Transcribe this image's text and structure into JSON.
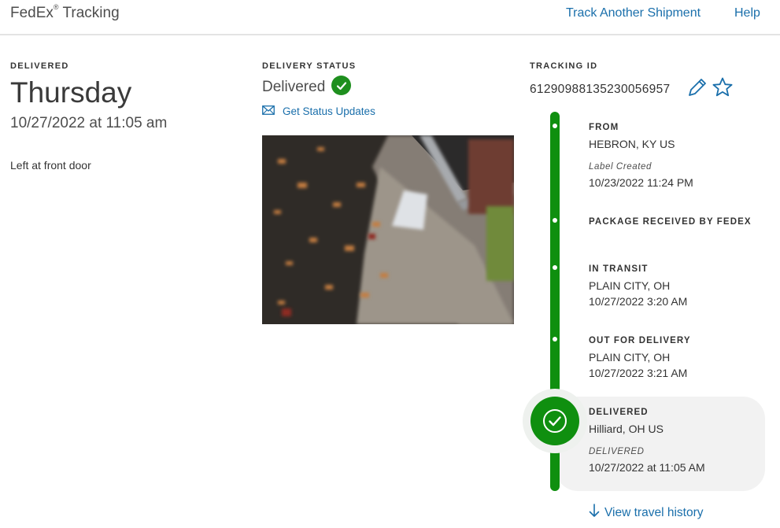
{
  "header": {
    "brand": "FedEx",
    "brand_mark": "®",
    "brand_suffix": "Tracking",
    "nav": {
      "track_another": "Track Another Shipment",
      "help": "Help"
    }
  },
  "delivered_panel": {
    "label": "DELIVERED",
    "day": "Thursday",
    "datetime": "10/27/2022 at 11:05 am",
    "note": "Left at front door"
  },
  "status_panel": {
    "label": "DELIVERY STATUS",
    "status": "Delivered",
    "updates_link": "Get Status Updates",
    "icons": {
      "status": "check-circle-icon",
      "updates": "envelope-icon"
    }
  },
  "tracking": {
    "label": "TRACKING ID",
    "id": "612909881352300569​57",
    "icons": [
      "pencil-icon",
      "star-icon"
    ]
  },
  "timeline": {
    "events": [
      {
        "title": "FROM",
        "line1": "HEBRON, KY US",
        "italic": "Label Created",
        "line2": "10/23/2022 11:24 PM"
      },
      {
        "title": "PACKAGE RECEIVED BY FEDEX"
      },
      {
        "title": "IN TRANSIT",
        "line1": "PLAIN CITY, OH",
        "line2": "10/27/2022 3:20 AM"
      },
      {
        "title": "OUT FOR DELIVERY",
        "line1": "PLAIN CITY, OH",
        "line2": "10/27/2022 3:21 AM"
      },
      {
        "title": "DELIVERED",
        "line1": "Hilliard, OH US",
        "italic": "DELIVERED",
        "line2": "10/27/2022 at 11:05 AM"
      }
    ],
    "history_link": "View travel history"
  },
  "colors": {
    "accent_green": "#0f8f0f",
    "link_blue": "#1a6fab"
  }
}
